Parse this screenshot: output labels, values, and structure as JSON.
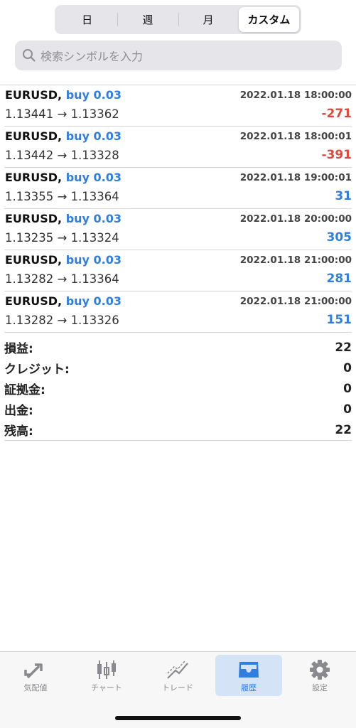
{
  "period_tabs": [
    {
      "label": "日",
      "active": false
    },
    {
      "label": "週",
      "active": false
    },
    {
      "label": "月",
      "active": false
    },
    {
      "label": "カスタム",
      "active": true
    }
  ],
  "search": {
    "placeholder": "検索シンボルを入力",
    "icon": "search-icon"
  },
  "trades": [
    {
      "symbol": "EURUSD,",
      "side": "buy 0.03",
      "time": "2022.01.18 18:00:00",
      "open": "1.13441",
      "close": "1.13362",
      "profit": "-271",
      "profit_color": "#e0473c"
    },
    {
      "symbol": "EURUSD,",
      "side": "buy 0.03",
      "time": "2022.01.18 18:00:01",
      "open": "1.13442",
      "close": "1.13328",
      "profit": "-391",
      "profit_color": "#e0473c"
    },
    {
      "symbol": "EURUSD,",
      "side": "buy 0.03",
      "time": "2022.01.18 19:00:01",
      "open": "1.13355",
      "close": "1.13364",
      "profit": "31",
      "profit_color": "#2f7ee0"
    },
    {
      "symbol": "EURUSD,",
      "side": "buy 0.03",
      "time": "2022.01.18 20:00:00",
      "open": "1.13235",
      "close": "1.13324",
      "profit": "305",
      "profit_color": "#2f7ee0"
    },
    {
      "symbol": "EURUSD,",
      "side": "buy 0.03",
      "time": "2022.01.18 21:00:00",
      "open": "1.13282",
      "close": "1.13364",
      "profit": "281",
      "profit_color": "#2f7ee0"
    },
    {
      "symbol": "EURUSD,",
      "side": "buy 0.03",
      "time": "2022.01.18 21:00:00",
      "open": "1.13282",
      "close": "1.13326",
      "profit": "151",
      "profit_color": "#2f7ee0"
    }
  ],
  "arrow": "→",
  "summary": [
    {
      "label": "損益:",
      "value": "22"
    },
    {
      "label": "クレジット:",
      "value": "0"
    },
    {
      "label": "証拠金:",
      "value": "0"
    },
    {
      "label": "出金:",
      "value": "0"
    },
    {
      "label": "残高:",
      "value": "22"
    }
  ],
  "tabbar": [
    {
      "label": "気配値",
      "icon": "quotes-arrows-icon",
      "active": false
    },
    {
      "label": "チャート",
      "icon": "candlestick-chart-icon",
      "active": false
    },
    {
      "label": "トレード",
      "icon": "trade-line-icon",
      "active": false
    },
    {
      "label": "履歴",
      "icon": "history-inbox-icon",
      "active": true
    },
    {
      "label": "設定",
      "icon": "settings-gear-icon",
      "active": false
    }
  ],
  "colors": {
    "accent": "#2f7ee0",
    "loss": "#e0473c",
    "active_tab_bg": "#d5e3f7"
  }
}
